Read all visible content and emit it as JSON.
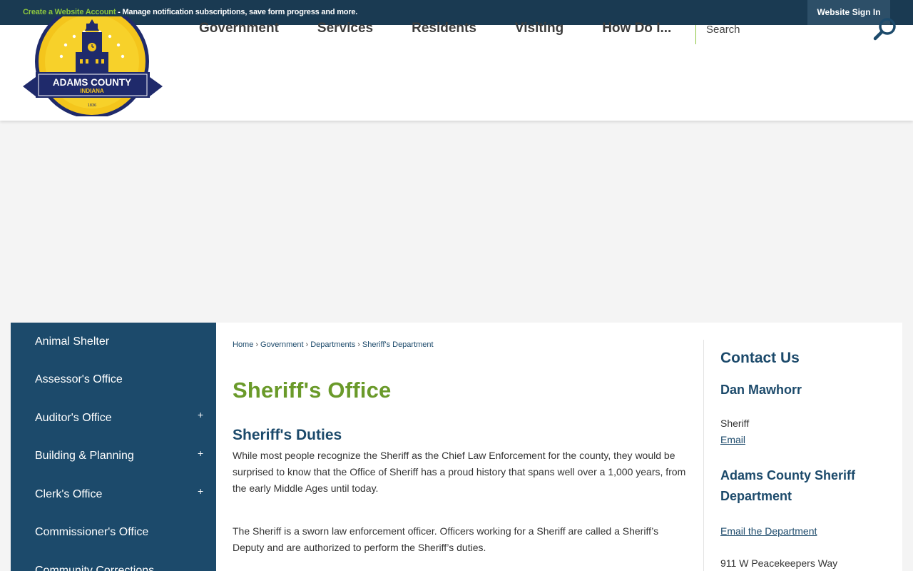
{
  "topbar": {
    "create_link": "Create a Website Account",
    "message": " - Manage notification subscriptions, save form progress and more.",
    "signin_label": "Website Sign In"
  },
  "logo": {
    "name": "ADAMS COUNTY",
    "state": "INDIANA",
    "year": "1836"
  },
  "nav": [
    "Government",
    "Services",
    "Residents",
    "Visiting",
    "How Do I..."
  ],
  "search": {
    "placeholder": "Search"
  },
  "sidebar": {
    "items": [
      {
        "label": "Animal Shelter",
        "expandable": false
      },
      {
        "label": "Assessor's Office",
        "expandable": false
      },
      {
        "label": "Auditor's Office",
        "expandable": true
      },
      {
        "label": "Building & Planning",
        "expandable": true
      },
      {
        "label": "Clerk's Office",
        "expandable": true
      },
      {
        "label": "Commissioner's Office",
        "expandable": false
      },
      {
        "label": "Community Corrections",
        "expandable": false
      }
    ],
    "expand_symbol": "+"
  },
  "breadcrumb": [
    "Home",
    "Government",
    "Departments",
    "Sheriff's Department"
  ],
  "breadcrumb_sep": "›",
  "main": {
    "title": "Sheriff's Office",
    "section_title": "Sheriff's Duties",
    "para1": "While most people recognize the Sheriff as the Chief Law Enforcement for the county, they would be surprised to know that the Office of Sheriff has a proud history that spans well over a 1,000 years, from the early Middle Ages until today.",
    "para2": "The Sheriff is a sworn law enforcement officer. Officers working for a Sheriff are called a Sheriff’s Deputy and are authorized to perform the Sheriff’s duties."
  },
  "contact": {
    "title": "Contact Us",
    "name": "Dan Mawhorr",
    "role": "Sheriff",
    "email_label": "Email",
    "dept_title": "Adams County Sheriff Department",
    "dept_email_label": "Email the Department",
    "address": "911 W Peacekeepers Way"
  },
  "colors": {
    "topbar": "#1a3a52",
    "accent_green": "#8cc63f",
    "title_green": "#6a9a2a",
    "navy": "#1c4a6b"
  }
}
